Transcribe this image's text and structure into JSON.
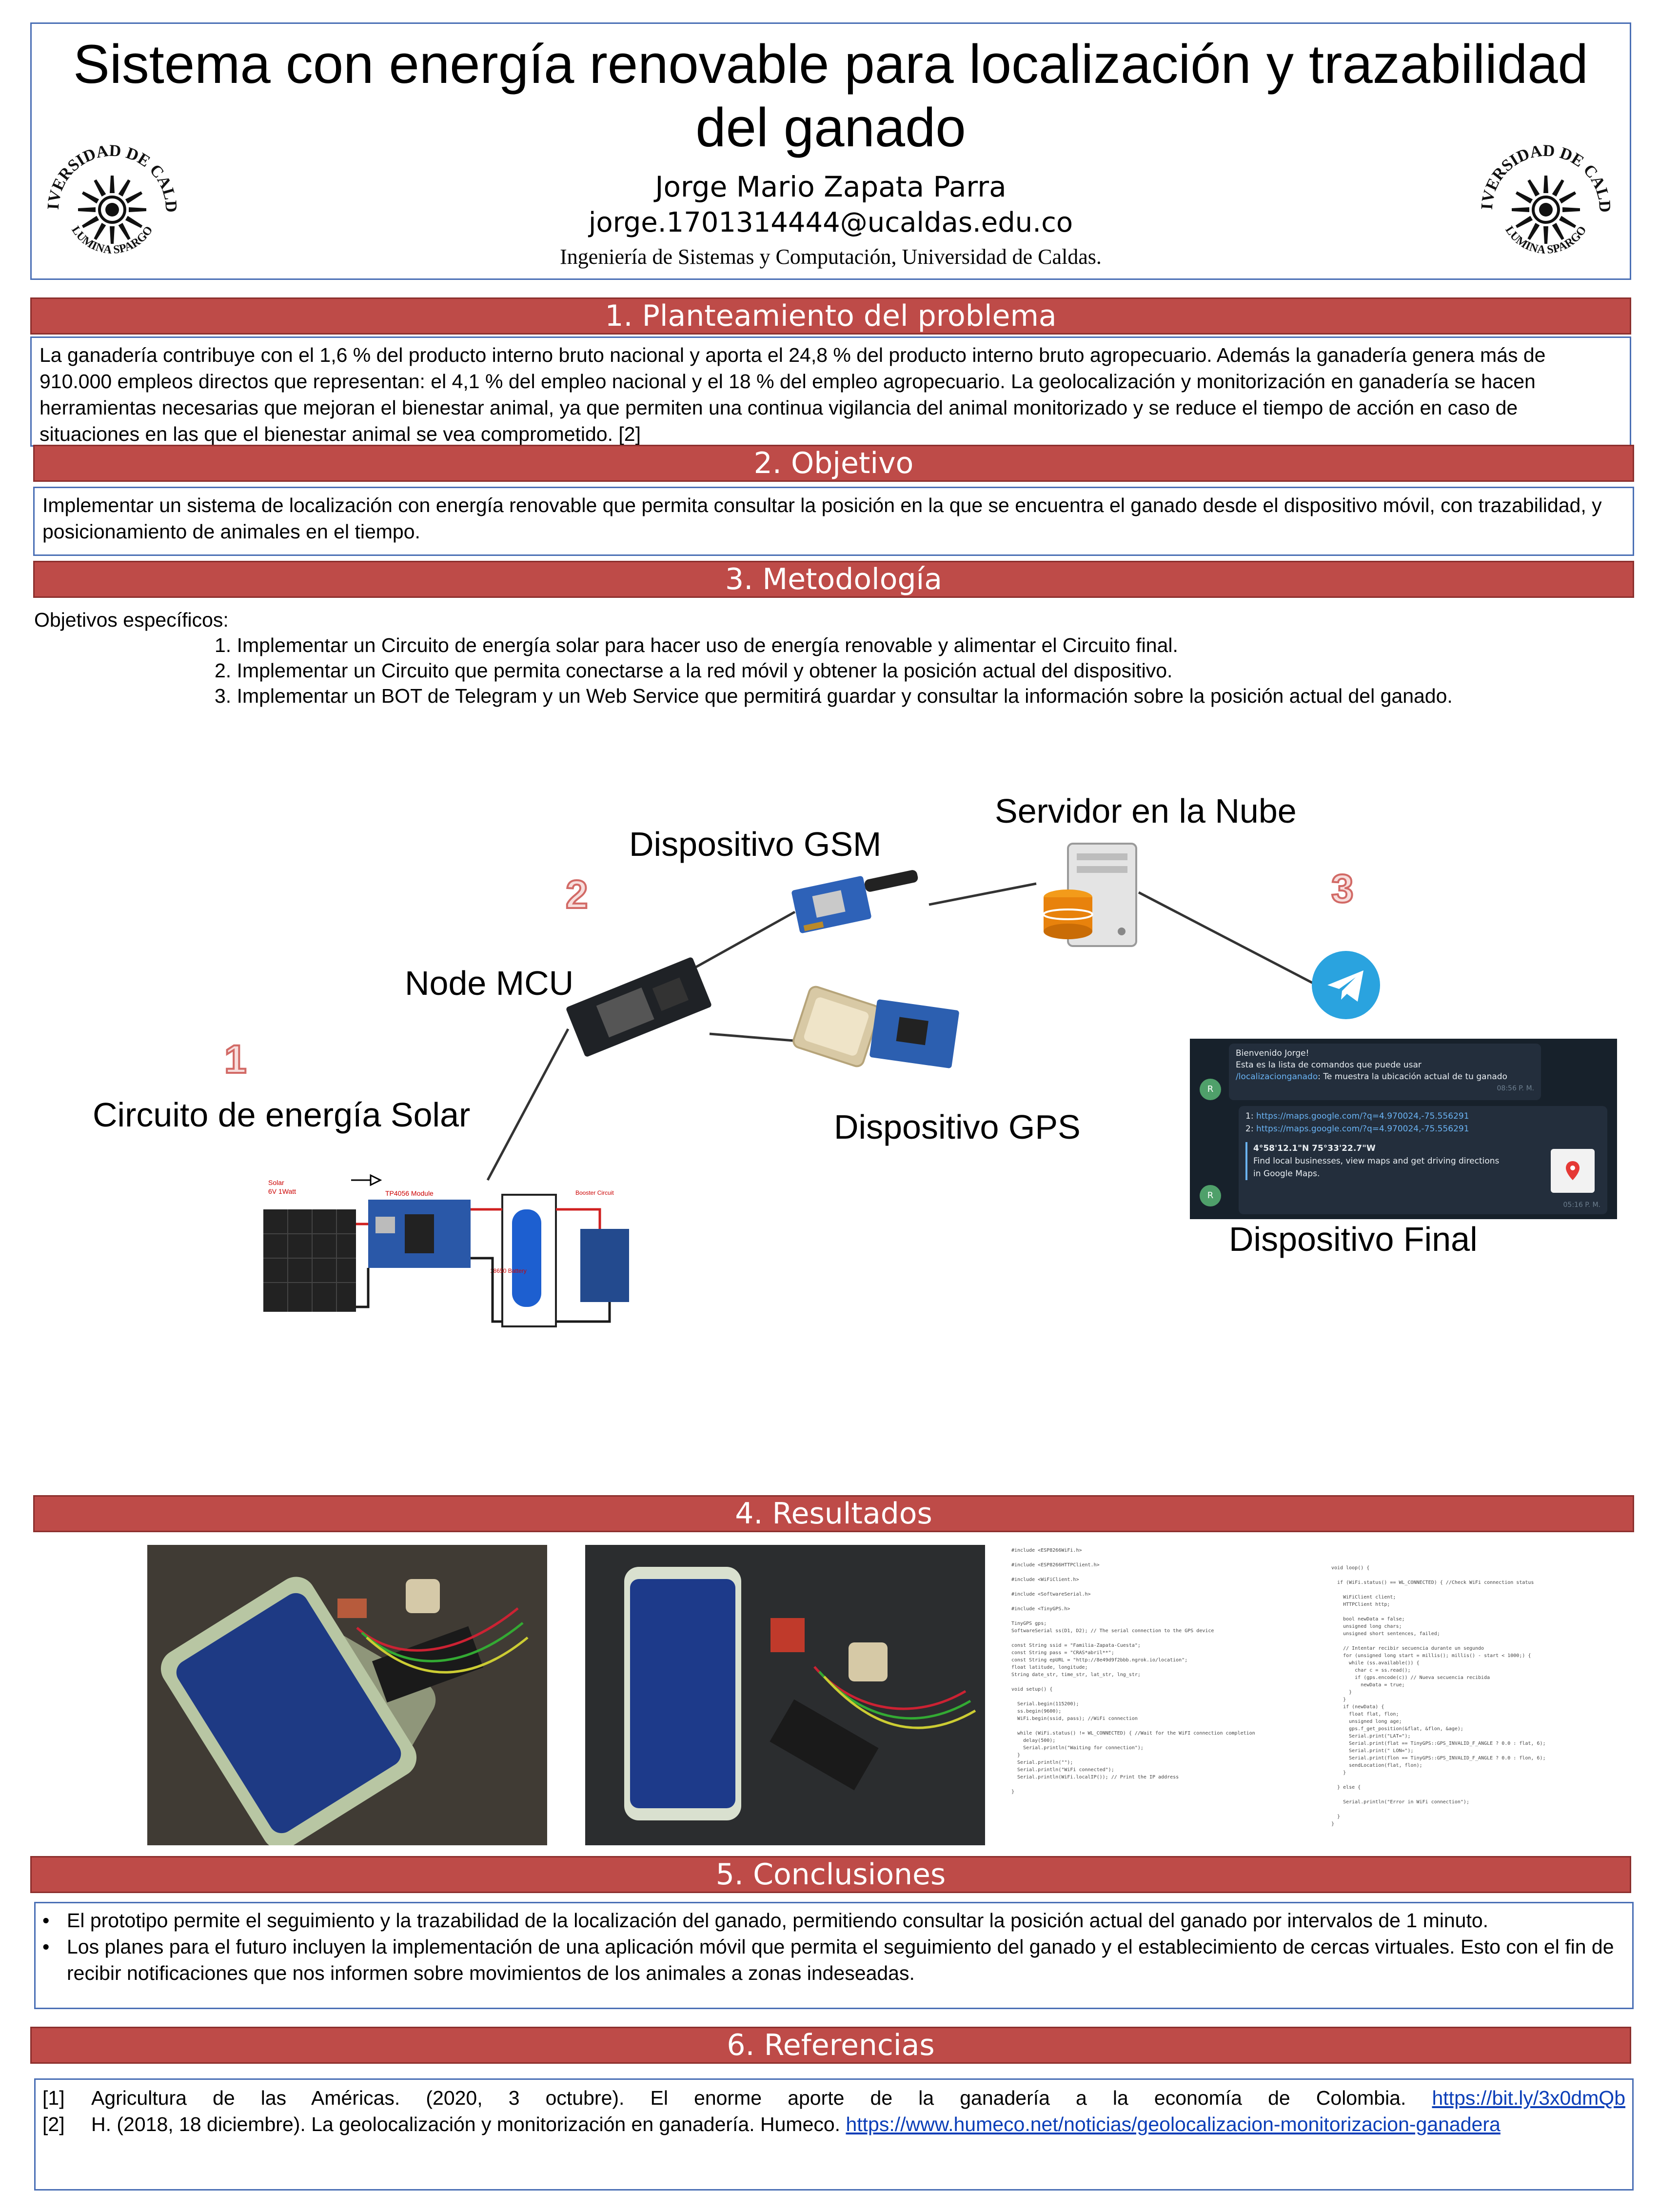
{
  "header": {
    "title": "Sistema con energía renovable para localización y trazabilidad del ganado",
    "author": "Jorge Mario Zapata Parra",
    "email": "jorge.1701314444@ucaldas.edu.co",
    "affiliation": "Ingeniería de Sistemas y Computación, Universidad de Caldas.",
    "logo_text_top": "UNIVERSIDAD DE CALDAS",
    "logo_text_bottom": "LUMINA SPARGO"
  },
  "sections": {
    "problema": {
      "title": "1. Planteamiento del problema",
      "text": "La ganadería contribuye con el 1,6 % del producto interno bruto nacional y aporta el 24,8 % del producto interno bruto agropecuario. Además la ganadería genera más de 910.000 empleos directos que representan: el 4,1 % del empleo nacional y el 18 % del empleo agropecuario. La geolocalización y monitorización en ganadería se hacen herramientas necesarias que mejoran el bienestar animal, ya que permiten una continua vigilancia del animal monitorizado y se reduce el tiempo de acción en caso de situaciones en las que el bienestar animal se vea comprometido. [2]"
    },
    "objetivo": {
      "title": "2. Objetivo",
      "text": "Implementar un sistema de localización con energía renovable que permita consultar la posición en la que se encuentra el ganado desde el dispositivo móvil, con trazabilidad, y posicionamiento de animales en el tiempo."
    },
    "metodologia": {
      "title": "3. Metodología",
      "intro": "Objetivos específicos:",
      "items": [
        "1. Implementar un Circuito de energía solar para hacer uso de energía renovable y alimentar el Circuito final.",
        "2. Implementar un Circuito que permita conectarse a la red móvil y obtener la posición actual del dispositivo.",
        "3. Implementar un BOT de Telegram y un Web Service que permitirá guardar y consultar la información sobre la posición actual del ganado."
      ]
    },
    "resultados": {
      "title": "4. Resultados"
    },
    "conclusiones": {
      "title": "5. Conclusiones",
      "items": [
        "El prototipo permite el seguimiento y la trazabilidad de la localización del ganado, permitiendo consultar la posición actual del ganado por intervalos de 1 minuto.",
        "Los planes para el futuro incluyen la implementación de una aplicación móvil que permita el seguimiento del ganado y el establecimiento de cercas virtuales. Esto con el fin de recibir notificaciones que nos informen sobre movimientos de los animales a zonas indeseadas."
      ]
    },
    "referencias": {
      "title": "6. Referencias",
      "items": [
        {
          "num": "[1]",
          "text": "Agricultura de las Américas. (2020, 3 octubre). El enorme aporte de la ganadería a la economía de Colombia.",
          "link": "https://bit.ly/3x0dmQb"
        },
        {
          "num": "[2]",
          "text": "H. (2018, 18 diciembre). La geolocalización y monitorización en ganadería. Humeco.",
          "link": "https://www.humeco.net/noticias/geolocalizacion-monitorizacion-ganadera"
        }
      ]
    }
  },
  "diagram": {
    "servidor": "Servidor en la Nube",
    "gsm": "Dispositivo GSM",
    "node": "Node MCU",
    "solar": "Circuito de energía Solar",
    "gps": "Dispositivo GPS",
    "final": "Dispositivo Final",
    "n1": "1",
    "n2": "2",
    "n3": "3",
    "circuit": {
      "solar": "Solar",
      "solar_spec": "6V 1Watt",
      "module": "TP4056 Module",
      "battery": "18650 Battery",
      "booster": "Booster Circuit"
    },
    "telegram": {
      "avatar": "R",
      "msg1_greeting": "Bienvenido Jorge!",
      "msg1_line2": "Esta es la lista de comandos que puede usar",
      "msg1_cmd": "/localizacionganado",
      "msg1_cmd_desc": ": Te muestra la ubicación actual de tu ganado",
      "msg1_time": "08:56 P. M.",
      "link1_num": "1:",
      "link1": "https://maps.google.com/?q=4.970024,-75.556291",
      "link2_num": "2:",
      "link2": "https://maps.google.com/?q=4.970024,-75.556291",
      "coords": "4°58'12.1\"N 75°33'22.7\"W",
      "card_desc": "Find local businesses, view maps and get driving directions in Google Maps.",
      "msg2_time": "05:16 P. M."
    }
  },
  "code": {
    "left": "#include <ESP8266WiFi.h>\n\n#include <ESP8266HTTPClient.h>\n\n#include <WiFiClient.h>\n\n#include <SoftwareSerial.h>\n\n#include <TinyGPS.h>\n\nTinyGPS gps;\nSoftwareSerial ss(D1, D2); // The serial connection to the GPS device\n\nconst String ssid = \"Familia-Zapata-Cuesta\";\nconst String pass = \"CRAS*abril**\";\nconst String epURL = \"http://8e49d9f2bbb.ngrok.io/location\";\nfloat latitude, longitude;\nString date_str, time_str, lat_str, lng_str;\n\nvoid setup() {\n\n  Serial.begin(115200);\n  ss.begin(9600);\n  WiFi.begin(ssid, pass); //WiFi connection\n\n  while (WiFi.status() != WL_CONNECTED) { //Wait for the WiFI connection completion\n    delay(500);\n    Serial.println(\"Waiting for connection\");\n  }\n  Serial.println(\"\");\n  Serial.println(\"WiFi connected\");\n  Serial.println(WiFi.localIP()); // Print the IP address\n\n}",
    "right": "void loop() {\n\n  if (WiFi.status() == WL_CONNECTED) { //Check WiFi connection status\n\n    WiFiClient client;\n    HTTPClient http;\n\n    bool newData = false;\n    unsigned long chars;\n    unsigned short sentences, failed;\n\n    // Intentar recibir secuencia durante un segundo\n    for (unsigned long start = millis(); millis() - start < 1000;) {\n      while (ss.available()) {\n        char c = ss.read();\n        if (gps.encode(c)) // Nueva secuencia recibida\n          newData = true;\n      }\n    }\n    if (newData) {\n      float flat, flon;\n      unsigned long age;\n      gps.f_get_position(&flat, &flon, &age);\n      Serial.print(\"LAT=\");\n      Serial.print(flat == TinyGPS::GPS_INVALID_F_ANGLE ? 0.0 : flat, 6);\n      Serial.print(\" LON=\");\n      Serial.print(flon == TinyGPS::GPS_INVALID_F_ANGLE ? 0.0 : flon, 6);\n      sendLocation(flat, flon);\n    }\n\n  } else {\n\n    Serial.println(\"Error in WiFi connection\");\n\n  }\n}"
  }
}
